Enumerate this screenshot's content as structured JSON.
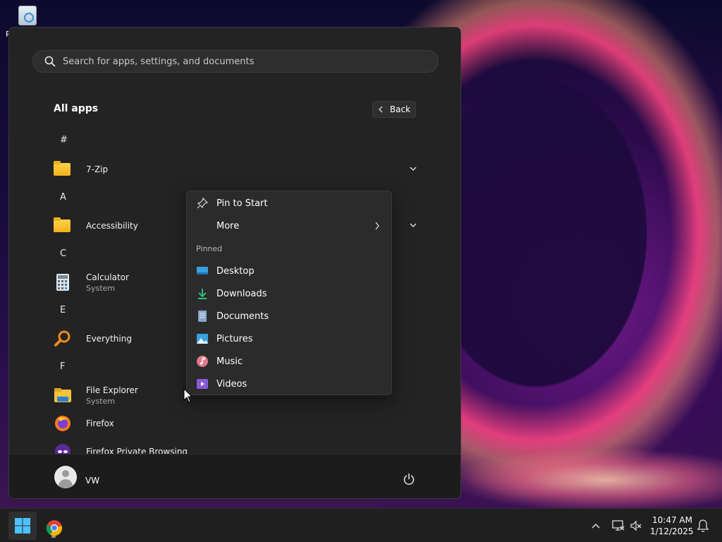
{
  "desktop": {
    "recycle_bin_label": "R"
  },
  "start_menu": {
    "search": {
      "placeholder": "Search for apps, settings, and documents"
    },
    "title": "All apps",
    "back_label": "Back",
    "sections": [
      {
        "letter": "#",
        "apps": [
          {
            "name": "7-Zip",
            "sub": "",
            "icon": "folder-icon",
            "expandable": true
          }
        ]
      },
      {
        "letter": "A",
        "apps": [
          {
            "name": "Accessibility",
            "sub": "",
            "icon": "folder-icon",
            "expandable": true
          }
        ]
      },
      {
        "letter": "C",
        "apps": [
          {
            "name": "Calculator",
            "sub": "System",
            "icon": "calculator-icon",
            "expandable": false
          }
        ]
      },
      {
        "letter": "E",
        "apps": [
          {
            "name": "Everything",
            "sub": "",
            "icon": "magnifier-icon",
            "expandable": false
          }
        ]
      },
      {
        "letter": "F",
        "apps": [
          {
            "name": "File Explorer",
            "sub": "System",
            "icon": "file-explorer-icon",
            "expandable": false
          },
          {
            "name": "Firefox",
            "sub": "",
            "icon": "firefox-icon",
            "expandable": false
          },
          {
            "name": "Firefox Private Browsing",
            "sub": "",
            "icon": "firefox-private-icon",
            "expandable": false
          }
        ]
      }
    ],
    "user": {
      "name": "VW"
    }
  },
  "context_menu": {
    "pin_to_start": "Pin to Start",
    "more": "More",
    "pinned_header": "Pinned",
    "pinned_items": [
      "Desktop",
      "Downloads",
      "Documents",
      "Pictures",
      "Music",
      "Videos"
    ]
  },
  "taskbar": {
    "time": "10:47 AM",
    "date": "1/12/2025"
  },
  "colors": {
    "accent": "#0078d4",
    "menu_bg": "#232323",
    "context_bg": "#2b2b2b",
    "taskbar_bg": "#1f1f1f"
  }
}
